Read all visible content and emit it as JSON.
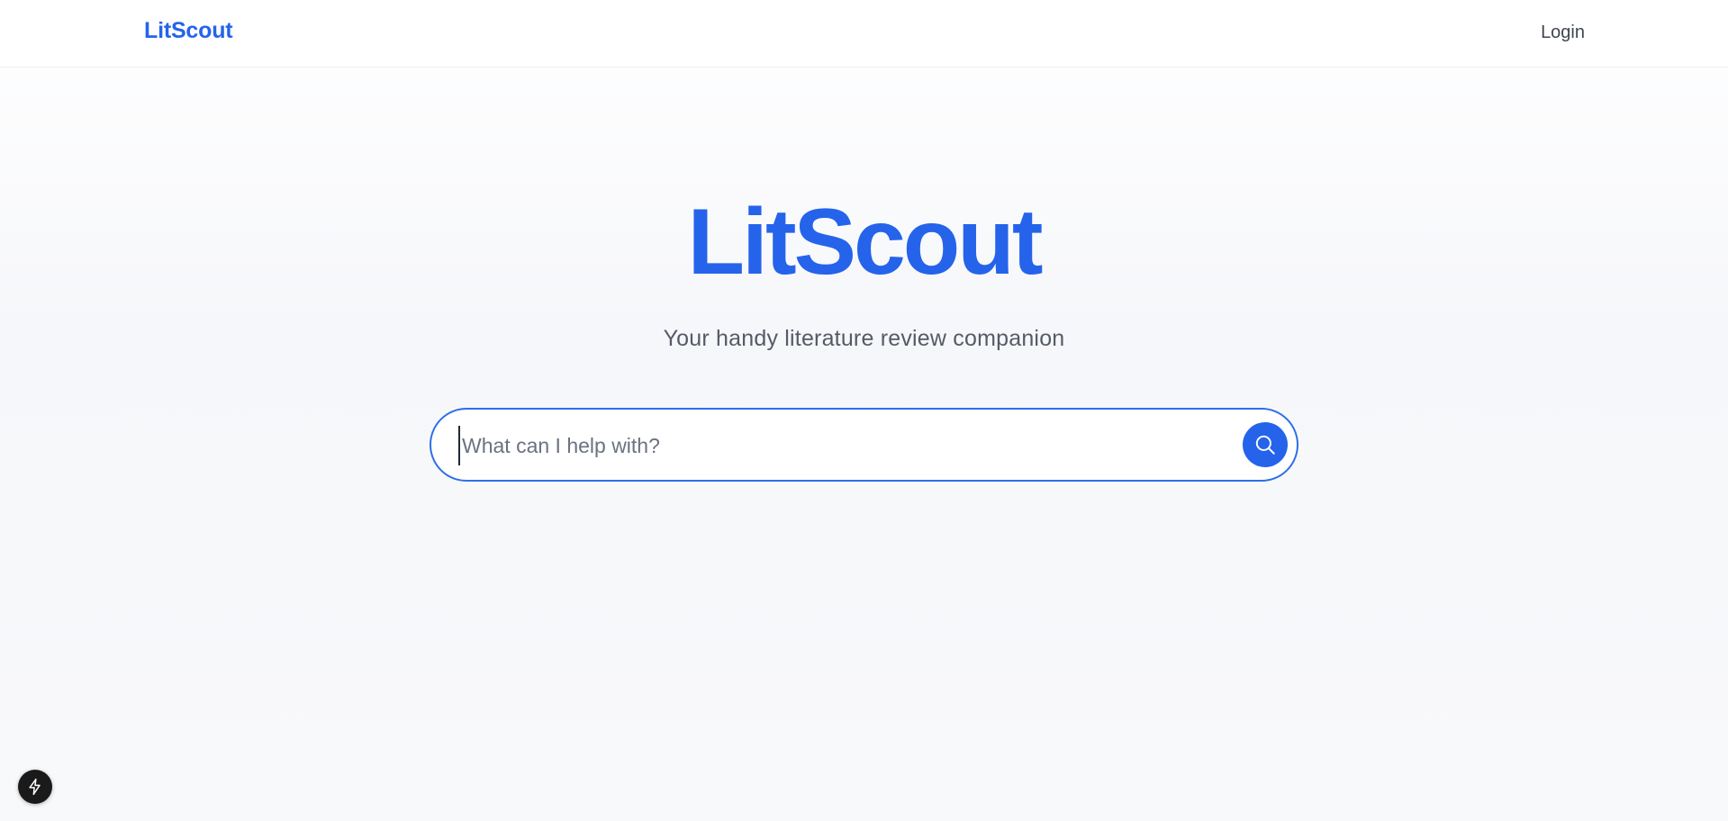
{
  "header": {
    "brand": "LitScout",
    "login_label": "Login"
  },
  "hero": {
    "title": "LitScout",
    "subtitle": "Your handy literature review companion"
  },
  "search": {
    "value": "",
    "placeholder": "What can I help with?",
    "button_icon": "search-icon"
  },
  "dev_badge": {
    "icon": "lightning-icon"
  },
  "colors": {
    "accent": "#2563eb",
    "text_muted": "#555b66",
    "dev_badge_bg": "#1a1a1a"
  }
}
